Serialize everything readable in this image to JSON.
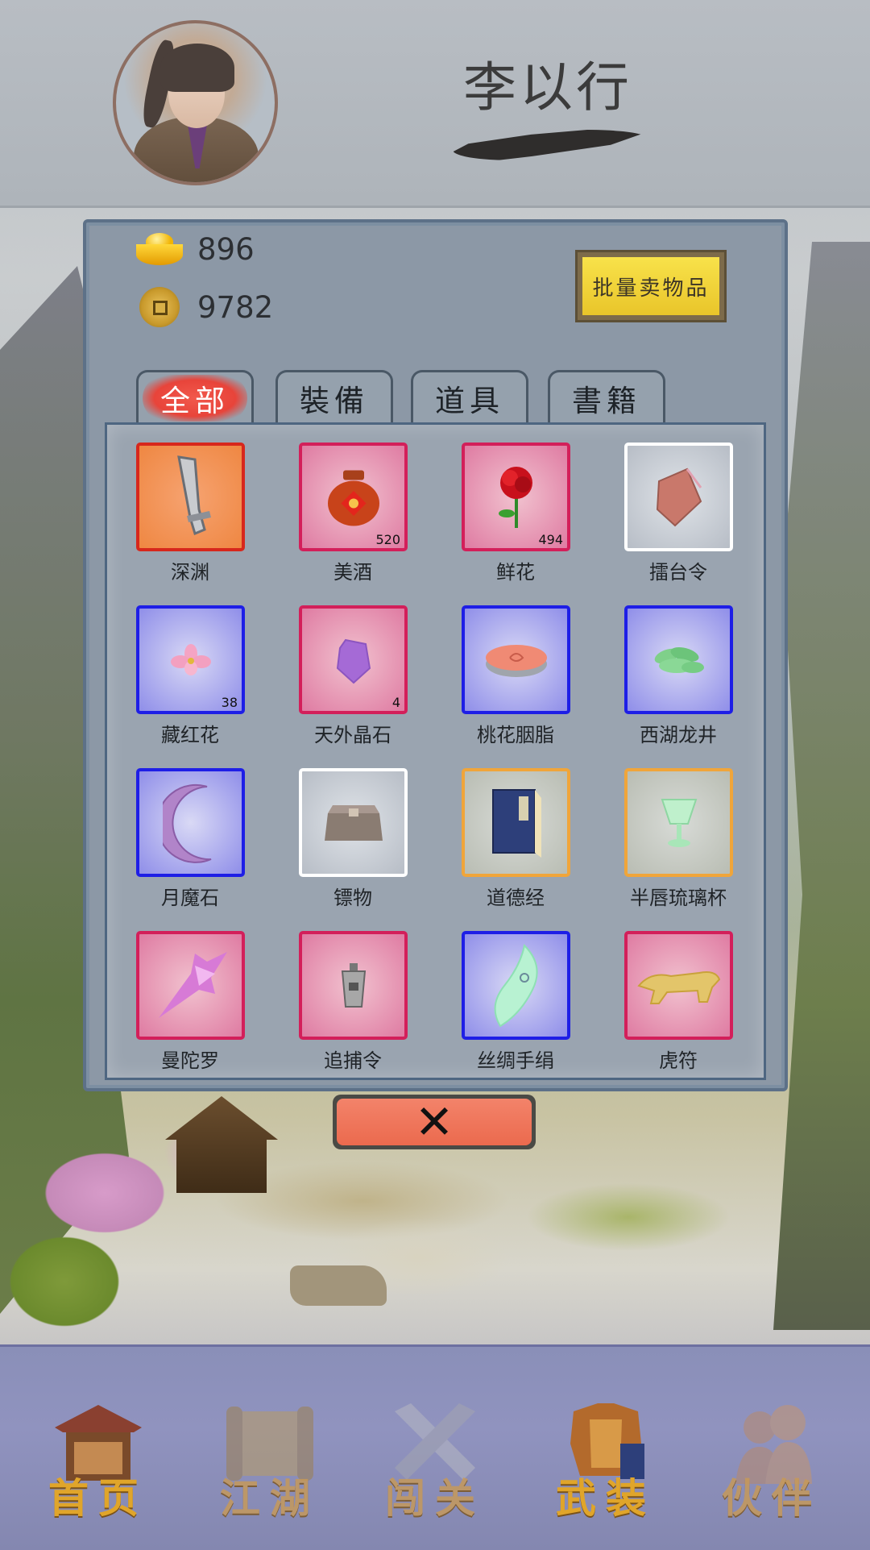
{
  "player": {
    "name": "李以行"
  },
  "currency": {
    "gold": "896",
    "coins": "9782"
  },
  "actions": {
    "bulk_sell_label": "批量卖物品",
    "close_label": "✕"
  },
  "tabs": [
    {
      "label": "全部",
      "active": true
    },
    {
      "label": "裝備",
      "active": false
    },
    {
      "label": "道具",
      "active": false
    },
    {
      "label": "書籍",
      "active": false
    }
  ],
  "items": [
    {
      "name": "深渊",
      "count": "",
      "tier": "orange",
      "icon": "sword-icon"
    },
    {
      "name": "美酒",
      "count": "520",
      "tier": "red",
      "icon": "wine-jar-icon"
    },
    {
      "name": "鲜花",
      "count": "494",
      "tier": "red",
      "icon": "rose-icon"
    },
    {
      "name": "擂台令",
      "count": "",
      "tier": "white",
      "icon": "token-icon"
    },
    {
      "name": "藏红花",
      "count": "38",
      "tier": "blue",
      "icon": "saffron-flower-icon"
    },
    {
      "name": "天外晶石",
      "count": "4",
      "tier": "red",
      "icon": "crystal-icon"
    },
    {
      "name": "桃花胭脂",
      "count": "",
      "tier": "blue",
      "icon": "rouge-box-icon"
    },
    {
      "name": "西湖龙井",
      "count": "",
      "tier": "blue",
      "icon": "tea-leaves-icon"
    },
    {
      "name": "月魔石",
      "count": "",
      "tier": "blue",
      "icon": "crescent-moon-icon"
    },
    {
      "name": "镖物",
      "count": "",
      "tier": "white",
      "icon": "cargo-box-icon"
    },
    {
      "name": "道德经",
      "count": "",
      "tier": "gold",
      "icon": "book-icon"
    },
    {
      "name": "半唇琉璃杯",
      "count": "",
      "tier": "gold",
      "icon": "glass-cup-icon"
    },
    {
      "name": "曼陀罗",
      "count": "",
      "tier": "red",
      "icon": "datura-flower-icon"
    },
    {
      "name": "追捕令",
      "count": "",
      "tier": "red",
      "icon": "warrant-tag-icon"
    },
    {
      "name": "丝绸手绢",
      "count": "",
      "tier": "blue",
      "icon": "silk-handkerchief-icon"
    },
    {
      "name": "虎符",
      "count": "",
      "tier": "red",
      "icon": "tiger-tally-icon"
    }
  ],
  "nav": [
    {
      "label": "首页",
      "icon": "house-icon",
      "active": true
    },
    {
      "label": "江湖",
      "icon": "scroll-icon",
      "active": false
    },
    {
      "label": "闯关",
      "icon": "crossed-swords-icon",
      "active": false
    },
    {
      "label": "武装",
      "icon": "armor-icon",
      "active": true
    },
    {
      "label": "伙伴",
      "icon": "companions-icon",
      "active": false
    }
  ],
  "colors": {
    "tier_red": "#d31f5a",
    "tier_orange": "#d7271c",
    "tier_white": "#ffffff",
    "tier_blue": "#1e1ee6",
    "tier_gold": "#f0a53a",
    "sell_button": "#f8e24a",
    "close_button": "#eb6a4e",
    "active_tab": "#e8443a",
    "nav_label": "#e0a52a"
  }
}
